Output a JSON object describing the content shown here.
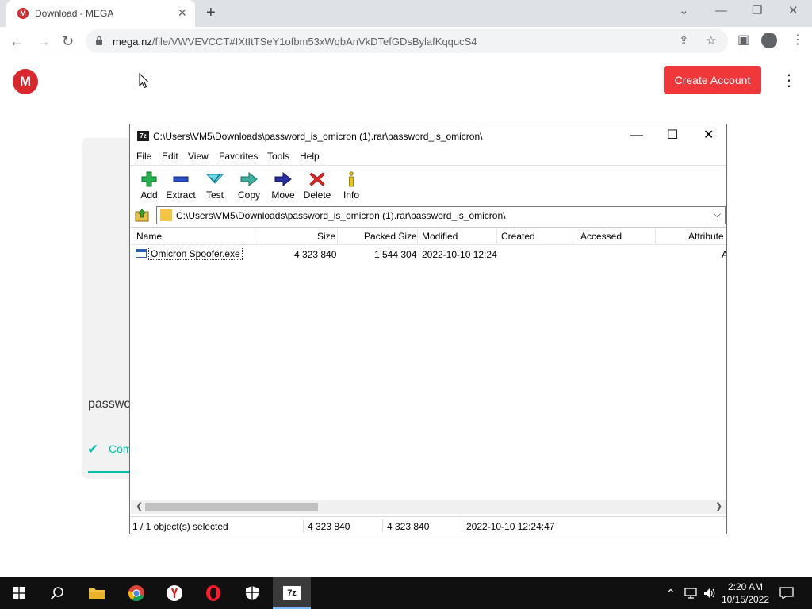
{
  "browser": {
    "tab_title": "Download - MEGA",
    "tab_favicon_letter": "M",
    "new_tab_symbol": "+",
    "close_symbol": "✕",
    "url_domain": "mega.nz",
    "url_path": "/file/VWVEVCCT#IXtItTSeY1ofbm53xWqbAnVkDTefGDsBylafKqqucS4"
  },
  "mega": {
    "logo_letter": "M",
    "create_account_label": "Create Account",
    "filename_partial": "passwo",
    "status_partial": "Com",
    "accent": "#f0373a",
    "success_color": "#00bfa5"
  },
  "sevenzip": {
    "title_icon_text": "7z",
    "title": "C:\\Users\\VM5\\Downloads\\password_is_omicron (1).rar\\password_is_omicron\\",
    "menu": [
      "File",
      "Edit",
      "View",
      "Favorites",
      "Tools",
      "Help"
    ],
    "toolbar": [
      {
        "label": "Add",
        "icon": "add-icon"
      },
      {
        "label": "Extract",
        "icon": "extract-icon"
      },
      {
        "label": "Test",
        "icon": "test-icon"
      },
      {
        "label": "Copy",
        "icon": "copy-icon"
      },
      {
        "label": "Move",
        "icon": "move-icon"
      },
      {
        "label": "Delete",
        "icon": "delete-icon"
      },
      {
        "label": "Info",
        "icon": "info-icon"
      }
    ],
    "address": "C:\\Users\\VM5\\Downloads\\password_is_omicron (1).rar\\password_is_omicron\\",
    "columns": [
      "Name",
      "Size",
      "Packed Size",
      "Modified",
      "Created",
      "Accessed",
      "Attribute"
    ],
    "rows": [
      {
        "name": "Omicron Spoofer.exe",
        "size": "4 323 840",
        "packed": "1 544 304",
        "modified": "2022-10-10 12:24",
        "created": "",
        "accessed": "",
        "attr": "A"
      }
    ],
    "status": {
      "selected": "1 / 1 object(s) selected",
      "size": "4 323 840",
      "packed": "4 323 840",
      "modified": "2022-10-10 12:24:47"
    }
  },
  "taskbar": {
    "time": "2:20 AM",
    "date": "10/15/2022",
    "active_app_label": "7z"
  }
}
